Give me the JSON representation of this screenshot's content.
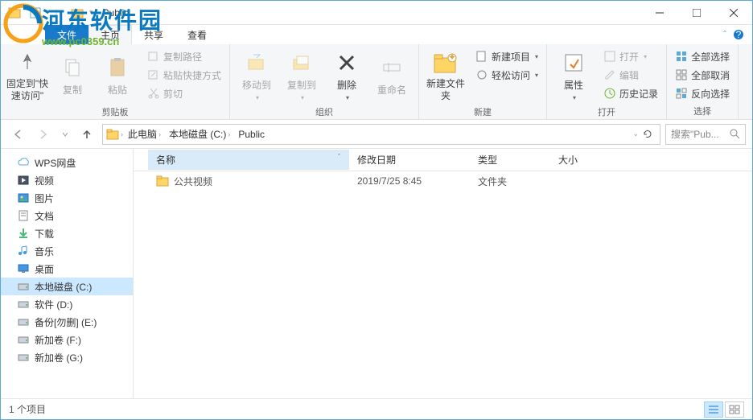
{
  "window": {
    "title": "Public"
  },
  "watermark": {
    "title": "河东软件园",
    "url": "www.pc0359.cn"
  },
  "tabs": {
    "file": "文件",
    "home": "主页",
    "share": "共享",
    "view": "查看"
  },
  "ribbon": {
    "clipboard": {
      "label": "剪贴板",
      "pin": "固定到\"快速访问\"",
      "copy": "复制",
      "paste": "粘贴",
      "copypath": "复制路径",
      "pasteshortcut": "粘贴快捷方式",
      "cut": "剪切"
    },
    "organize": {
      "label": "组织",
      "moveto": "移动到",
      "copyto": "复制到",
      "delete": "删除",
      "rename": "重命名"
    },
    "new": {
      "label": "新建",
      "newfolder": "新建文件夹",
      "newitem": "新建项目",
      "easyaccess": "轻松访问"
    },
    "open": {
      "label": "打开",
      "properties": "属性",
      "open": "打开",
      "edit": "编辑",
      "history": "历史记录"
    },
    "select": {
      "label": "选择",
      "selectall": "全部选择",
      "selectnone": "全部取消",
      "invert": "反向选择"
    }
  },
  "breadcrumbs": {
    "pc": "此电脑",
    "drive": "本地磁盘 (C:)",
    "folder": "Public"
  },
  "search": {
    "placeholder": "搜索\"Pub..."
  },
  "sidebar": {
    "items": [
      {
        "label": "WPS网盘",
        "icon": "cloud"
      },
      {
        "label": "视频",
        "icon": "video"
      },
      {
        "label": "图片",
        "icon": "picture"
      },
      {
        "label": "文档",
        "icon": "document"
      },
      {
        "label": "下载",
        "icon": "download"
      },
      {
        "label": "音乐",
        "icon": "music"
      },
      {
        "label": "桌面",
        "icon": "desktop"
      },
      {
        "label": "本地磁盘 (C:)",
        "icon": "drive",
        "selected": true
      },
      {
        "label": "软件 (D:)",
        "icon": "drive"
      },
      {
        "label": "备份[勿删] (E:)",
        "icon": "drive"
      },
      {
        "label": "新加卷 (F:)",
        "icon": "drive"
      },
      {
        "label": "新加卷 (G:)",
        "icon": "drive"
      }
    ]
  },
  "columns": {
    "name": "名称",
    "modified": "修改日期",
    "type": "类型",
    "size": "大小"
  },
  "files": [
    {
      "name": "公共视频",
      "modified": "2019/7/25 8:45",
      "type": "文件夹",
      "size": ""
    }
  ],
  "status": {
    "count": "1 个项目"
  }
}
